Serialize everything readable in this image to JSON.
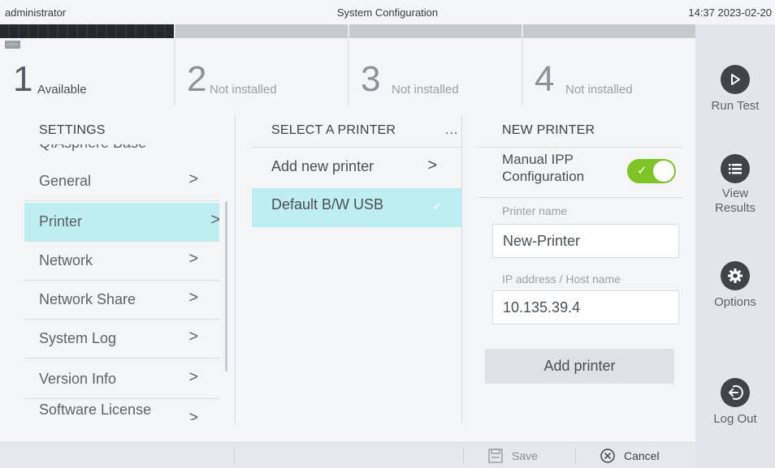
{
  "topbar": {
    "user": "administrator",
    "title": "System Configuration",
    "clock": "14:37 2023-02-20"
  },
  "slots": [
    {
      "dash": "--:--",
      "number": "1",
      "status": "Available"
    },
    {
      "number": "2",
      "status": "Not installed"
    },
    {
      "number": "3",
      "status": "Not installed"
    },
    {
      "number": "4",
      "status": "Not installed"
    }
  ],
  "rail": {
    "run_test": "Run Test",
    "view_results": "View Results",
    "options": "Options",
    "log_out": "Log Out"
  },
  "settings": {
    "header": "SETTINGS",
    "cut_item": "QIAsphere Base",
    "items": [
      "General",
      "Printer",
      "Network",
      "Network Share",
      "System Log",
      "Version Info",
      "Software License Agreement"
    ],
    "selected": "Printer"
  },
  "printers": {
    "header": "SELECT A PRINTER",
    "more": "...",
    "items": [
      "Add new printer",
      "Default B/W USB"
    ],
    "selected": "Default B/W USB"
  },
  "new_printer": {
    "header": "NEW PRINTER",
    "manual_ipp_label": "Manual IPP Configuration",
    "manual_ipp_on": true,
    "printer_name_label": "Printer name",
    "printer_name_value": "New-Printer",
    "ip_label": "IP address / Host name",
    "ip_value": "10.135.39.4",
    "add_button": "Add printer"
  },
  "bottombar": {
    "save": "Save",
    "cancel": "Cancel"
  },
  "colors": {
    "selection": "#bfeef0",
    "toggle_on": "#7cc524",
    "rail_icon": "#3f4448"
  },
  "icons": [
    "play-icon",
    "list-icon",
    "gear-icon",
    "logout-icon",
    "save-icon",
    "cancel-icon",
    "chevron-right-icon",
    "check-icon"
  ]
}
